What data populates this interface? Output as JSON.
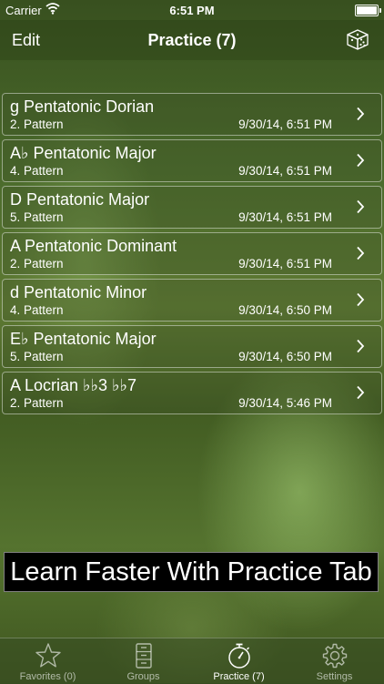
{
  "status": {
    "carrier": "Carrier",
    "time": "6:51 PM"
  },
  "nav": {
    "edit_label": "Edit",
    "title": "Practice (7)"
  },
  "rows": [
    {
      "name": "g Pentatonic Dorian",
      "pattern": "2. Pattern",
      "date": "9/30/14, 6:51 PM"
    },
    {
      "name": "A♭ Pentatonic Major",
      "pattern": "4. Pattern",
      "date": "9/30/14, 6:51 PM"
    },
    {
      "name": "D Pentatonic Major",
      "pattern": "5. Pattern",
      "date": "9/30/14, 6:51 PM"
    },
    {
      "name": "A Pentatonic Dominant",
      "pattern": "2. Pattern",
      "date": "9/30/14, 6:51 PM"
    },
    {
      "name": "d Pentatonic Minor",
      "pattern": "4. Pattern",
      "date": "9/30/14, 6:50 PM"
    },
    {
      "name": "E♭ Pentatonic Major",
      "pattern": "5. Pattern",
      "date": "9/30/14, 6:50 PM"
    },
    {
      "name": "A Locrian ♭♭3 ♭♭7",
      "pattern": "2. Pattern",
      "date": "9/30/14, 5:46 PM"
    }
  ],
  "banner": {
    "text": "Learn Faster With Practice Tab"
  },
  "tabs": [
    {
      "label": "Favorites (0)",
      "icon": "star-icon",
      "active": false
    },
    {
      "label": "Groups",
      "icon": "cabinet-icon",
      "active": false
    },
    {
      "label": "Practice (7)",
      "icon": "stopwatch-icon",
      "active": true
    },
    {
      "label": "Settings",
      "icon": "gear-icon",
      "active": false
    }
  ]
}
